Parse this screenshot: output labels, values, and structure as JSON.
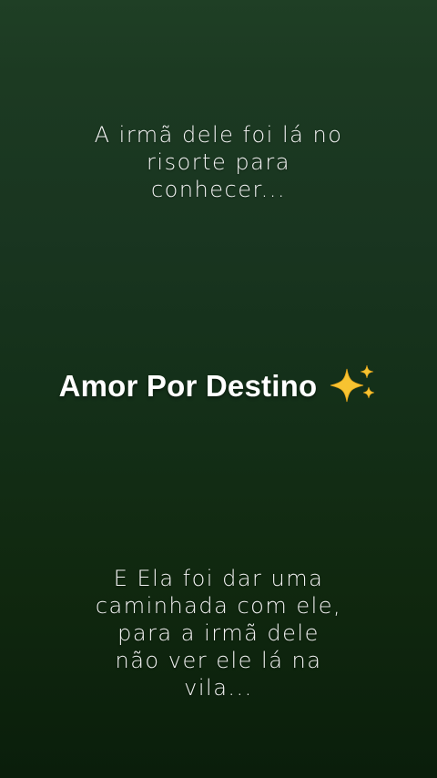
{
  "story": {
    "caption_top": {
      "lines": [
        "A irmã dele foi lá no",
        "risorte para",
        "conhecer..."
      ]
    },
    "title": {
      "text": "Amor Por Destino",
      "icon": "sparkles-icon"
    },
    "caption_bottom": {
      "lines": [
        "E Ela foi dar uma",
        "caminhada com ele,",
        "para a irmã dele",
        "não ver ele lá na",
        "vila..."
      ]
    }
  },
  "colors": {
    "background_top": "#1f3f25",
    "background_bottom": "#0a1e0b",
    "text": "#ffffff",
    "sparkle": "#f7c331"
  }
}
